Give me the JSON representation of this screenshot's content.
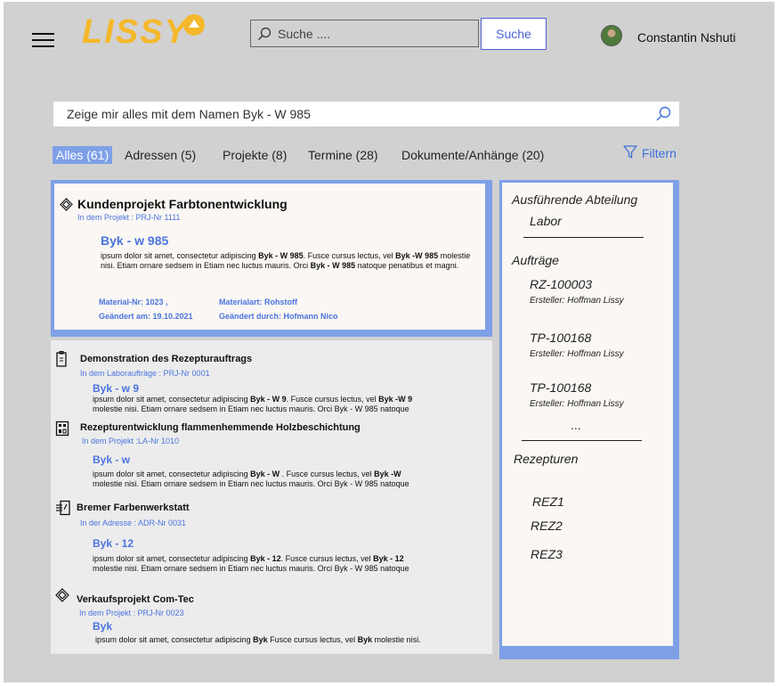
{
  "header": {
    "logo": "LISSY",
    "search_placeholder": "Suche ....",
    "search_button": "Suche",
    "user_name": "Constantin Nshuti"
  },
  "main_search": {
    "query": "Zeige mir alles mit dem Namen Byk - W 985"
  },
  "tabs": [
    {
      "label": "Alles (61)",
      "active": true
    },
    {
      "label": "Adressen (5)",
      "active": false
    },
    {
      "label": "Projekte (8)",
      "active": false
    },
    {
      "label": "Termine (28)",
      "active": false
    },
    {
      "label": "Dokumente/Anhänge (20)",
      "active": false
    }
  ],
  "filter_label": "Filtern",
  "featured": {
    "icon": "diamond-project-icon",
    "title": "Kundenprojekt Farbtonentwicklung",
    "subtitle": "In dem Projekt : PRJ-Nr 1111",
    "match": "Byk - w 985",
    "text": [
      {
        "t": "ipsum dolor sit amet, consectetur adipiscing ",
        "b": false
      },
      {
        "t": "Byk - W 985",
        "b": true
      },
      {
        "t": ". Fusce cursus lectus, vel ",
        "b": false
      },
      {
        "t": "Byk -W 985",
        "b": true
      },
      {
        "t": " molestie nisi. Etiam ornare sedsem in Etiam nec luctus mauris. Orci ",
        "b": false
      },
      {
        "t": "Byk - W 985",
        "b": true
      },
      {
        "t": " natoque penatibus et magni.",
        "b": false
      }
    ],
    "meta": {
      "material_nr": "Material-Nr: 1023 ,",
      "material_art": "Materialart:  Rohstoff",
      "changed_on": "Geändert am: 19.10.2021",
      "changed_by": "Geändert durch:  Hofmann Nico"
    }
  },
  "results": [
    {
      "icon": "device-icon",
      "title": "Demonstration des Rezepturauftrags",
      "subtitle": "In dem Laboraufträge : PRJ-Nr 0001",
      "match": "Byk - w 9",
      "line1": [
        {
          "t": "ipsum dolor sit amet, consectetur adipiscing ",
          "b": false
        },
        {
          "t": "Byk - W 9",
          "b": true
        },
        {
          "t": ". Fusce cursus lectus, vel ",
          "b": false
        },
        {
          "t": "Byk -W 9",
          "b": true
        }
      ],
      "line2": "molestie nisi. Etiam ornare sedsem in Etiam nec luctus mauris. Orci Byk - W 985 natoque"
    },
    {
      "icon": "panel-icon",
      "title": "Rezepturentwicklung flammenhemmende Holzbeschichtung",
      "subtitle": "In dem Projekt :LA-Nr 1010",
      "match": "Byk - w",
      "line1": [
        {
          "t": "ipsum dolor sit amet, consectetur adipiscing ",
          "b": false
        },
        {
          "t": "Byk - W",
          "b": true
        },
        {
          "t": " . Fusce cursus lectus, vel ",
          "b": false
        },
        {
          "t": "Byk -W",
          "b": true
        }
      ],
      "line2": "molestie nisi. Etiam ornare sedsem in Etiam nec luctus mauris. Orci Byk - W 985 natoque"
    },
    {
      "icon": "address-icon",
      "title": "Bremer Farbenwerkstatt",
      "subtitle": "In der Adresse : ADR-Nr 0031",
      "match": "Byk - 12",
      "line1": [
        {
          "t": "ipsum dolor sit amet, consectetur adipiscing ",
          "b": false
        },
        {
          "t": "Byk - 12",
          "b": true
        },
        {
          "t": ". Fusce cursus lectus, vel ",
          "b": false
        },
        {
          "t": "Byk - 12",
          "b": true
        }
      ],
      "line2": "molestie nisi. Etiam ornare sedsem in Etiam nec luctus mauris. Orci Byk - W 985 natoque"
    },
    {
      "icon": "diamond-project-icon",
      "title": "Verkaufsprojekt Com-Tec",
      "subtitle": "In dem Projekt : PRJ-Nr 0023",
      "match": "Byk",
      "line1": [
        {
          "t": "ipsum dolor sit amet, consectetur adipiscing ",
          "b": false
        },
        {
          "t": "Byk",
          "b": true
        },
        {
          "t": "  Fusce cursus lectus, vel ",
          "b": false
        },
        {
          "t": "Byk",
          "b": true
        },
        {
          "t": "  molestie nisi.",
          "b": false
        }
      ],
      "line2": ""
    }
  ],
  "sidebar": {
    "dept_title": "Ausführende Abteilung",
    "dept_value": "Labor",
    "orders_title": "Aufträge",
    "orders": [
      {
        "id": "RZ-100003",
        "creator": "Ersteller: Hoffman Lissy"
      },
      {
        "id": "TP-100168",
        "creator": "Ersteller: Hoffman Lissy"
      },
      {
        "id": "TP-100168",
        "creator": "Ersteller: Hoffman Lissy"
      }
    ],
    "ellipsis": "...",
    "recipes_title": "Rezepturen",
    "recipes": [
      "REZ1",
      "REZ2",
      "REZ3"
    ]
  }
}
